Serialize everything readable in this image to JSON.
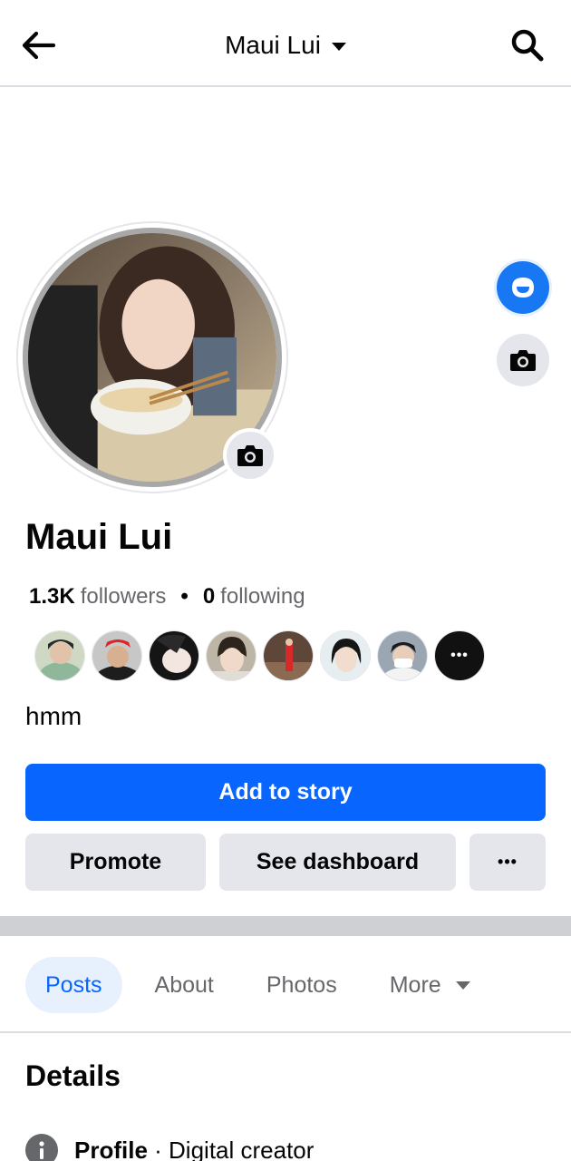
{
  "header": {
    "title": "Maui Lui",
    "back_icon": "arrow-left-icon",
    "search_icon": "search-icon"
  },
  "profile": {
    "name": "Maui Lui",
    "followers_count": "1.3K",
    "followers_label": "followers",
    "separator": "•",
    "following_count": "0",
    "following_label": "following",
    "bio": "hmm"
  },
  "friends_more_label": "•••",
  "buttons": {
    "add_to_story": "Add to story",
    "promote": "Promote",
    "see_dashboard": "See dashboard",
    "more": "•••"
  },
  "tabs": [
    {
      "label": "Posts",
      "active": true
    },
    {
      "label": "About",
      "active": false
    },
    {
      "label": "Photos",
      "active": false
    },
    {
      "label": "More",
      "active": false
    }
  ],
  "details": {
    "title": "Details",
    "profile_label": "Profile",
    "profile_sep": " · ",
    "profile_value": "Digital creator"
  },
  "colors": {
    "accent": "#0866ff",
    "secondary_bg": "#e4e6eb",
    "text_muted": "#65676b"
  }
}
